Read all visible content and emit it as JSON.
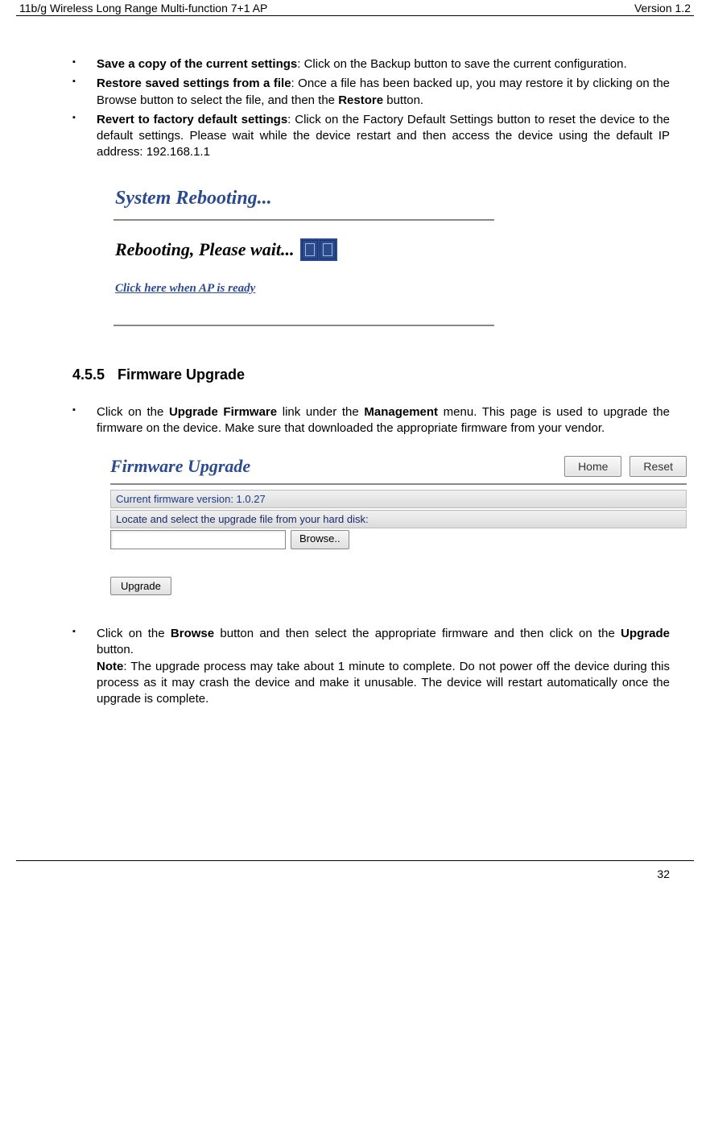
{
  "header": {
    "left": "11b/g Wireless Long Range Multi-function 7+1 AP",
    "right": "Version 1.2"
  },
  "bullets1": {
    "b1_bold": "Save a copy of the current settings",
    "b1_rest": ": Click on the Backup button to save the current configuration.",
    "b2_bold": "Restore saved settings from a file",
    "b2_mid": ": Once a file has been backed up, you may restore it by clicking on the Browse button to select the file, and then the ",
    "b2_bold2": "Restore",
    "b2_end": " button.",
    "b3_bold": "Revert to factory default settings",
    "b3_rest": ": Click on the Factory Default Settings button to reset the device to the default settings. Please wait while the device restart and then access the device using the default IP address: 192.168.1.1"
  },
  "reboot": {
    "title": "System Rebooting...",
    "wait": "Rebooting, Please wait...",
    "link": "Click here when AP is ready"
  },
  "section": {
    "num": "4.5.5",
    "title": "Firmware Upgrade"
  },
  "bullets2": {
    "b1_a": "Click on the ",
    "b1_b": "Upgrade Firmware",
    "b1_c": " link under the ",
    "b1_d": "Management",
    "b1_e": " menu. This page is used to upgrade the firmware on the device. Make sure that downloaded the appropriate firmware from your vendor."
  },
  "fw": {
    "title": "Firmware Upgrade",
    "home": "Home",
    "reset": "Reset",
    "version": "Current firmware version: 1.0.27",
    "locate": "Locate and select the upgrade file from your hard disk:",
    "browse": "Browse..",
    "upgrade": "Upgrade"
  },
  "bullets3": {
    "b1_a": "Click on the ",
    "b1_b": "Browse",
    "b1_c": " button and then select the appropriate firmware and then click on the ",
    "b1_d": "Upgrade",
    "b1_e": " button.",
    "note_label": "Note",
    "note_text": ": The upgrade process may take about 1 minute to complete. Do not power off the device during this process as it may crash the device and make it unusable. The device will restart automatically once the upgrade is complete."
  },
  "page_number": "32"
}
